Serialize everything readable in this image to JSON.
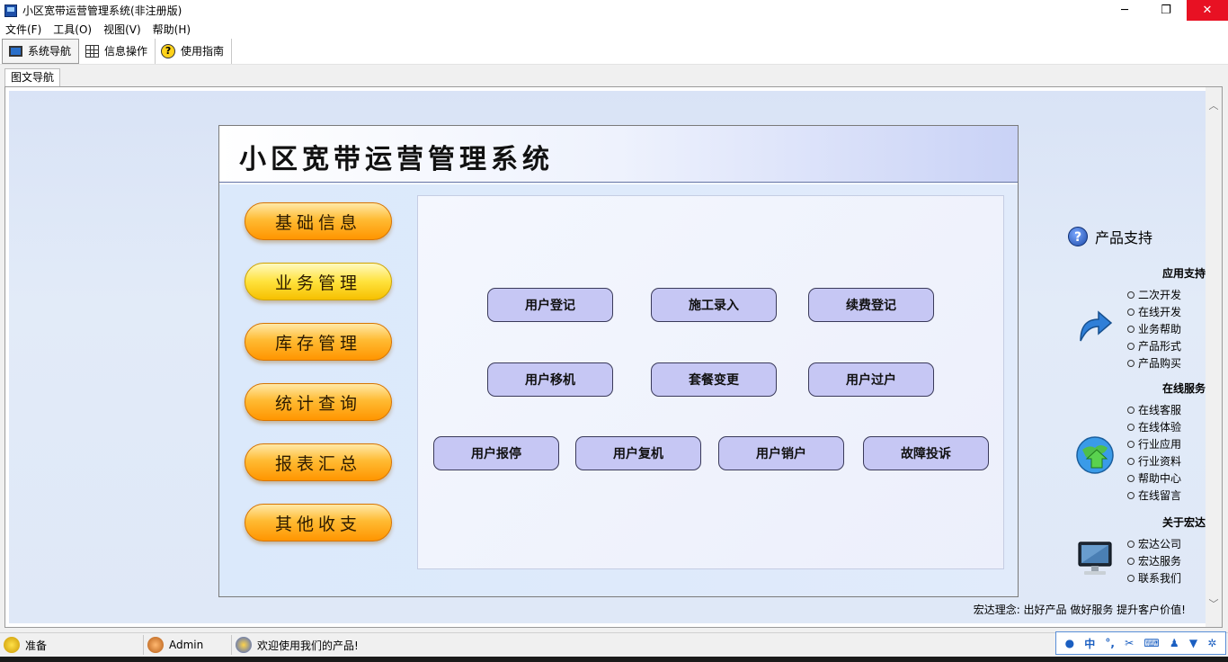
{
  "window": {
    "title": "小区宽带运营管理系统(非注册版)",
    "minimize": "─",
    "maximize": "❐",
    "close": "✕"
  },
  "menu": [
    "文件(F)",
    "工具(O)",
    "视图(V)",
    "帮助(H)"
  ],
  "toolbar": {
    "nav": "系统导航",
    "info": "信息操作",
    "guide": "使用指南"
  },
  "tab": "图文导航",
  "main": {
    "title": "小区宽带运营管理系统",
    "side_buttons": [
      "基础信息",
      "业务管理",
      "库存管理",
      "统计查询",
      "报表汇总",
      "其他收支"
    ],
    "ops": {
      "row1": [
        "用户登记",
        "施工录入",
        "续费登记"
      ],
      "row2": [
        "用户移机",
        "套餐变更",
        "用户过户"
      ],
      "row3": [
        "用户报停",
        "用户复机",
        "用户销户",
        "故障投诉"
      ]
    }
  },
  "support": {
    "title": "产品支持",
    "app_support": {
      "title": "应用支持",
      "items": [
        "二次开发",
        "在线开发",
        "业务帮助",
        "产品形式",
        "产品购买"
      ]
    },
    "online": {
      "title": "在线服务",
      "items": [
        "在线客服",
        "在线体验",
        "行业应用",
        "行业资料",
        "帮助中心",
        "在线留言"
      ]
    },
    "about": {
      "title": "关于宏达",
      "items": [
        "宏达公司",
        "宏达服务",
        "联系我们"
      ]
    }
  },
  "slogan": "宏达理念: 出好产品  做好服务  提升客户价值!",
  "status": {
    "ready": "准备",
    "user": "Admin",
    "welcome": "欢迎使用我们的产品!"
  },
  "ime": {
    "lang": "中"
  },
  "colors": {
    "orange_button": "#ff9500",
    "yellow_button": "#ffe23c",
    "op_button": "#c6c7f4",
    "close_red": "#e81123"
  }
}
